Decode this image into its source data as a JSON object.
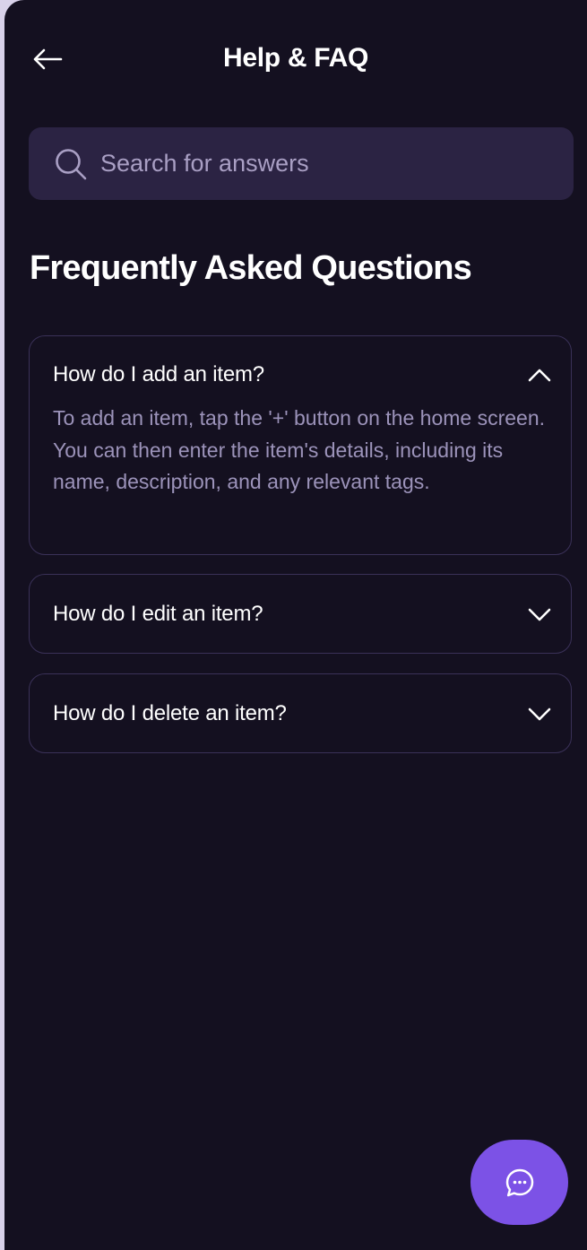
{
  "header": {
    "title": "Help & FAQ",
    "back_icon": "arrow-left-icon"
  },
  "search": {
    "placeholder": "Search for answers",
    "value": "",
    "icon": "search-icon"
  },
  "faq": {
    "heading": "Frequently Asked Questions",
    "items": [
      {
        "question": "How do I add an item?",
        "answer": "To add an item, tap the '+' button on the home screen. You can then enter the item's details, including its name, description, and any relevant tags.",
        "expanded": true,
        "icon": "chevron-up-icon"
      },
      {
        "question": "How do I edit an item?",
        "expanded": false,
        "icon": "chevron-down-icon"
      },
      {
        "question": "How do I delete an item?",
        "expanded": false,
        "icon": "chevron-down-icon"
      }
    ]
  },
  "chat_button": {
    "icon": "chat-bubble-icon"
  },
  "colors": {
    "background": "#141020",
    "search_background": "#2b2343",
    "card_border": "#3a3158",
    "answer_text": "#9c93ba",
    "accent": "#7c52e6"
  }
}
